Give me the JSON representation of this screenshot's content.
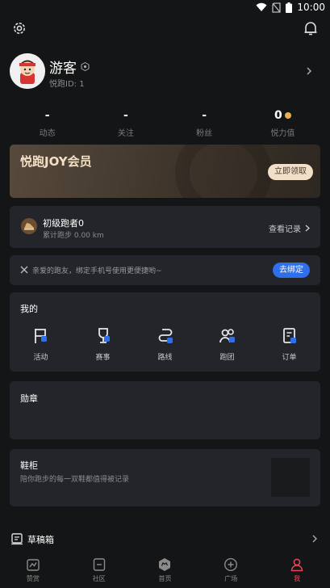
{
  "status_bar": {
    "time": "10:00"
  },
  "profile": {
    "nickname": "游客",
    "uid": "悦跑ID: 1"
  },
  "stats": [
    {
      "value": "-",
      "label": "动态"
    },
    {
      "value": "-",
      "label": "关注"
    },
    {
      "value": "-",
      "label": "粉丝"
    },
    {
      "value": "0",
      "label": "悦力值"
    }
  ],
  "joy": {
    "title": "悦跑JOY会员",
    "button": "立即领取"
  },
  "level": {
    "name": "初级跑者0",
    "distance": "累计跑步 0.00 km",
    "link": "查看记录"
  },
  "bind": {
    "text": "亲爱的跑友，绑定手机号使用更便捷哟~",
    "button": "去绑定"
  },
  "mine": {
    "title": "我的",
    "items": [
      {
        "label": "活动",
        "icon": "flag-icon"
      },
      {
        "label": "赛事",
        "icon": "trophy-icon"
      },
      {
        "label": "路线",
        "icon": "route-icon"
      },
      {
        "label": "跑团",
        "icon": "group-icon"
      },
      {
        "label": "订单",
        "icon": "order-icon"
      }
    ]
  },
  "medal": {
    "title": "勋章"
  },
  "shoes": {
    "title": "鞋柜",
    "subtitle": "陪你跑步的每一双鞋都值得被记录"
  },
  "draft": {
    "label": "草稿箱"
  },
  "tabs": [
    {
      "label": "赞赏",
      "icon": "chart-icon",
      "active": false
    },
    {
      "label": "社区",
      "icon": "community-icon",
      "active": false
    },
    {
      "label": "首页",
      "icon": "run-home-icon",
      "active": false
    },
    {
      "label": "广场",
      "icon": "plus-circle-icon",
      "active": false
    },
    {
      "label": "我",
      "icon": "profile-icon",
      "active": true
    }
  ],
  "colors": {
    "background": "#141516",
    "card": "#23252a",
    "accent_blue": "#2f6fe9",
    "accent_red": "#e5475b",
    "gold": "#e8b04a"
  }
}
